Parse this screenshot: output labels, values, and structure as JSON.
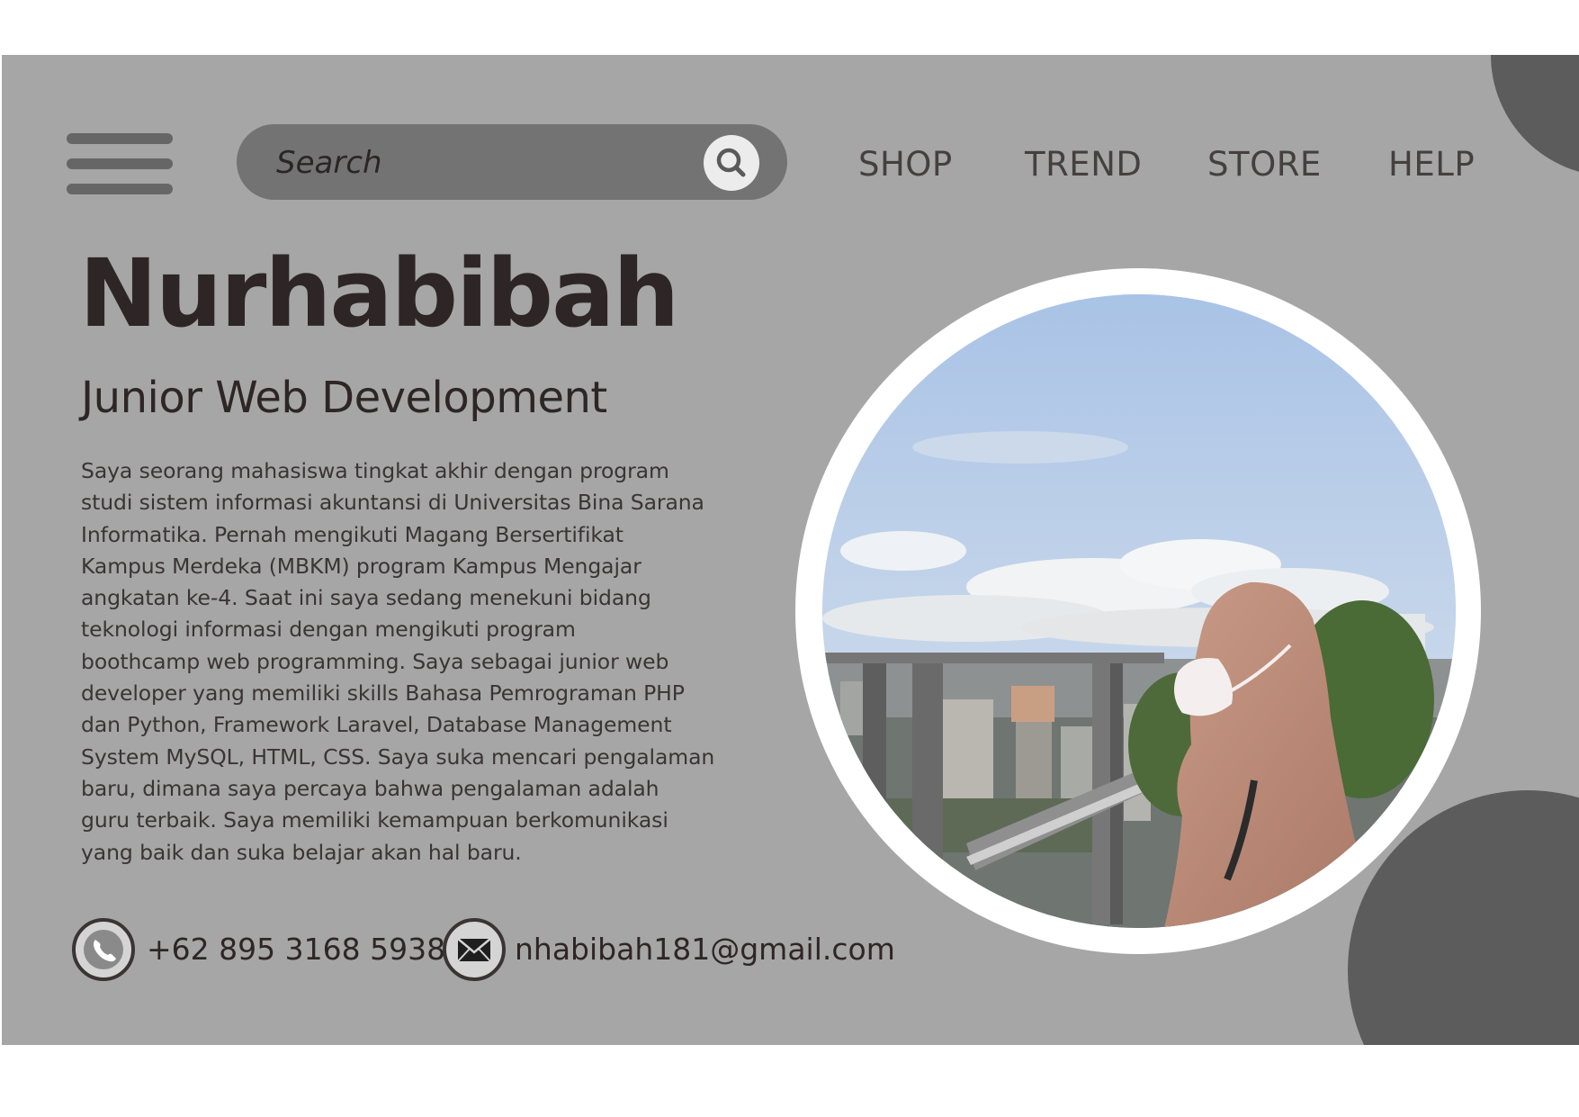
{
  "header": {
    "search_placeholder": "Search",
    "nav": [
      "SHOP",
      "TREND",
      "STORE",
      "HELP"
    ]
  },
  "profile": {
    "name": "Nurhabibah",
    "role": "Junior Web Development",
    "bio": "Saya seorang mahasiswa tingkat akhir dengan program studi sistem informasi akuntansi di Universitas Bina Sarana Informatika. Pernah mengikuti Magang Bersertifikat Kampus Merdeka (MBKM) program Kampus Mengajar angkatan ke-4. Saat ini saya sedang menekuni bidang teknologi informasi dengan mengikuti program boothcamp web programming. Saya sebagai junior web developer yang memiliki skills Bahasa Pemrograman PHP dan Python, Framework Laravel, Database Management System MySQL, HTML, CSS. Saya suka mencari pengalaman baru, dimana saya  percaya bahwa pengalaman adalah guru terbaik. Saya memiliki kemampuan berkomunikasi yang baik dan suka belajar akan hal baru.",
    "bio_lines": [
      "Saya seorang mahasiswa tingkat akhir dengan program",
      "studi sistem informasi akuntansi di Universitas Bina Sarana",
      "Informatika. Pernah mengikuti Magang Bersertifikat",
      "Kampus Merdeka (MBKM) program Kampus Mengajar",
      "angkatan ke-4. Saat ini saya sedang menekuni bidang",
      "teknologi informasi dengan mengikuti program",
      "boothcamp web programming. Saya sebagai junior web",
      "developer yang memiliki skills Bahasa Pemrograman PHP",
      "dan Python, Framework Laravel, Database Management",
      "System MySQL, HTML, CSS. Saya suka mencari pengalaman",
      "baru, dimana saya  percaya bahwa pengalaman adalah",
      "guru terbaik. Saya memiliki kemampuan berkomunikasi",
      "yang baik dan suka belajar akan hal baru."
    ]
  },
  "contact": {
    "phone": "+62 895 3168 5938",
    "email": "nhabibah181@gmail.com"
  },
  "icons": {
    "menu": "hamburger-menu-icon",
    "search": "search-icon",
    "phone": "phone-icon",
    "email": "envelope-icon"
  },
  "colors": {
    "background": "#a6a6a6",
    "accent_dark": "#5c5c5c",
    "text": "#2e2626",
    "search_pill": "#737373"
  }
}
